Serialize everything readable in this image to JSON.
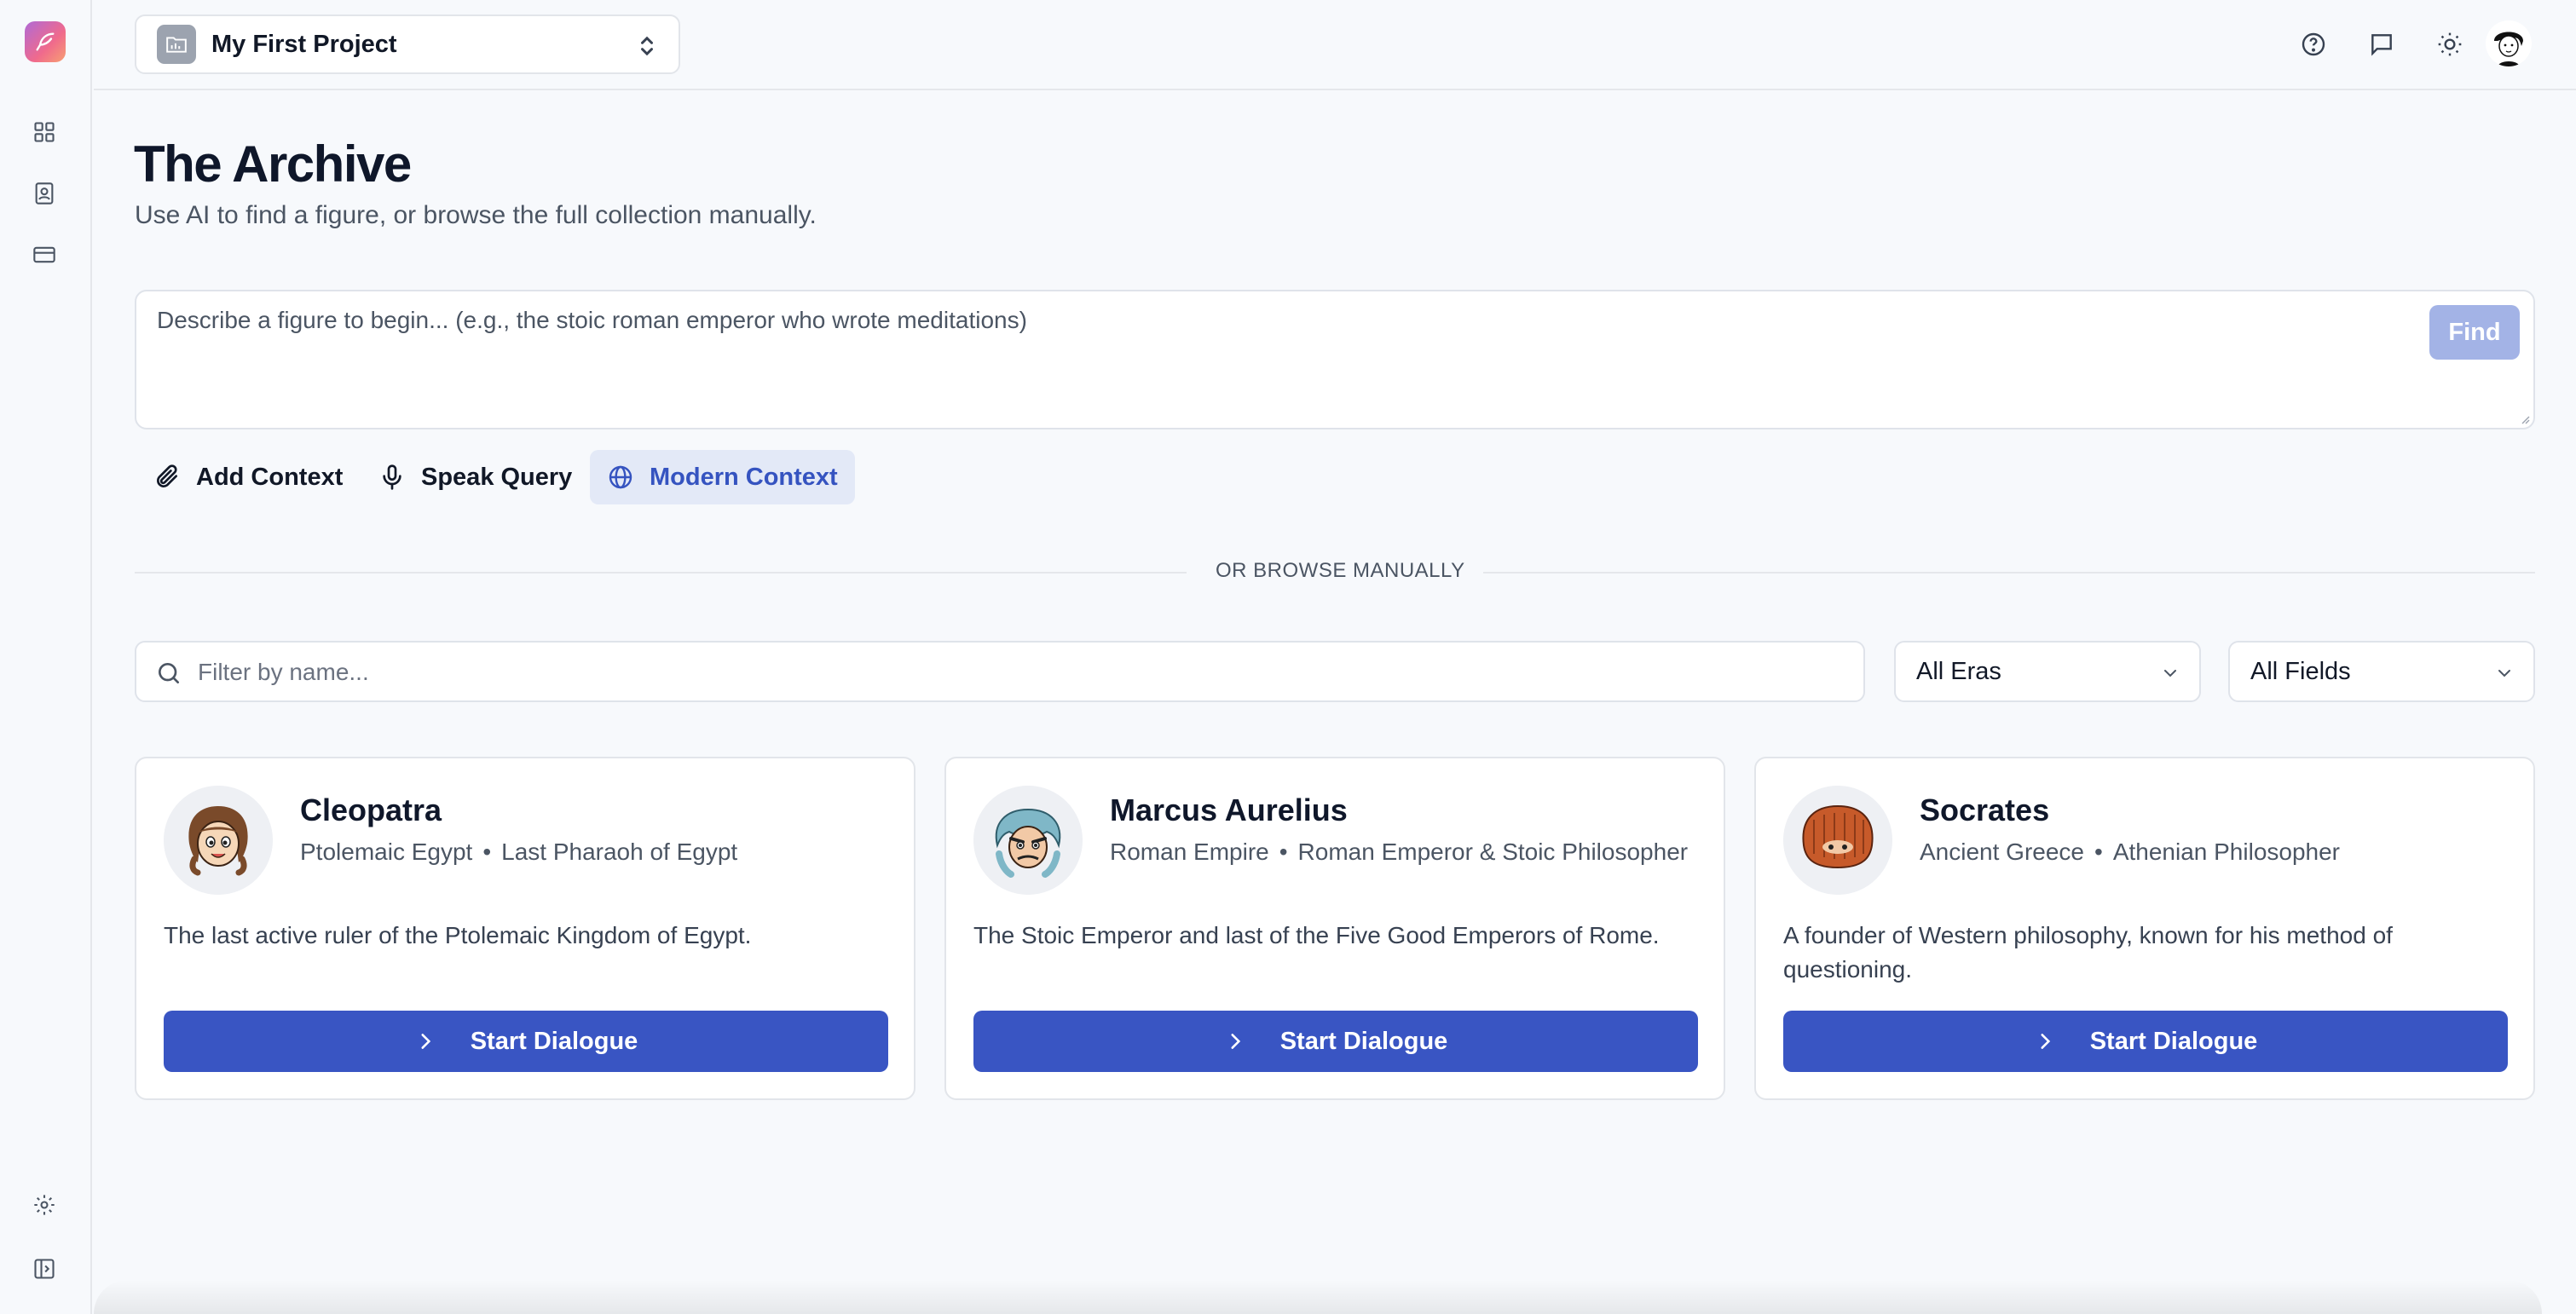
{
  "sidebar": {
    "logo": "feather-pen-icon",
    "nav_items": [
      {
        "name": "dashboard",
        "icon": "grid-icon"
      },
      {
        "name": "contacts",
        "icon": "contact-book-icon"
      },
      {
        "name": "billing",
        "icon": "credit-card-icon"
      }
    ],
    "bottom_items": [
      {
        "name": "settings",
        "icon": "gear-icon"
      },
      {
        "name": "toggle-sidebar",
        "icon": "sidebar-toggle-icon"
      }
    ]
  },
  "header": {
    "project_name": "My First Project",
    "icons": [
      "help-icon",
      "chat-icon",
      "sun-icon"
    ],
    "user_avatar": "user-avatar"
  },
  "main": {
    "title": "The Archive",
    "subtitle": "Use AI to find a figure, or browse the full collection manually.",
    "query": {
      "placeholder": "Describe a figure to begin... (e.g., the stoic roman emperor who wrote meditations)",
      "value": "",
      "find_label": "Find"
    },
    "tools": {
      "add_context": "Add Context",
      "speak_query": "Speak Query",
      "modern_context": "Modern Context"
    },
    "divider_label": "OR BROWSE MANUALLY",
    "filter": {
      "placeholder": "Filter by name...",
      "value": ""
    },
    "era_select": "All Eras",
    "field_select": "All Fields",
    "cards": [
      {
        "name": "Cleopatra",
        "era": "Ptolemaic Egypt",
        "role": "Last Pharaoh of Egypt",
        "description": "The last active ruler of the Ptolemaic Kingdom of Egypt.",
        "button": "Start Dialogue"
      },
      {
        "name": "Marcus Aurelius",
        "era": "Roman Empire",
        "role": "Roman Emperor & Stoic Philosopher",
        "description": "The Stoic Emperor and last of the Five Good Emperors of Rome.",
        "button": "Start Dialogue"
      },
      {
        "name": "Socrates",
        "era": "Ancient Greece",
        "role": "Athenian Philosopher",
        "description": "A founder of Western philosophy, known for his method of questioning.",
        "button": "Start Dialogue"
      }
    ],
    "meta_separator": "•"
  },
  "colors": {
    "accent": "#3955c3",
    "active_tool_bg": "#e3e9f7",
    "find_disabled": "#a3b3e6"
  }
}
